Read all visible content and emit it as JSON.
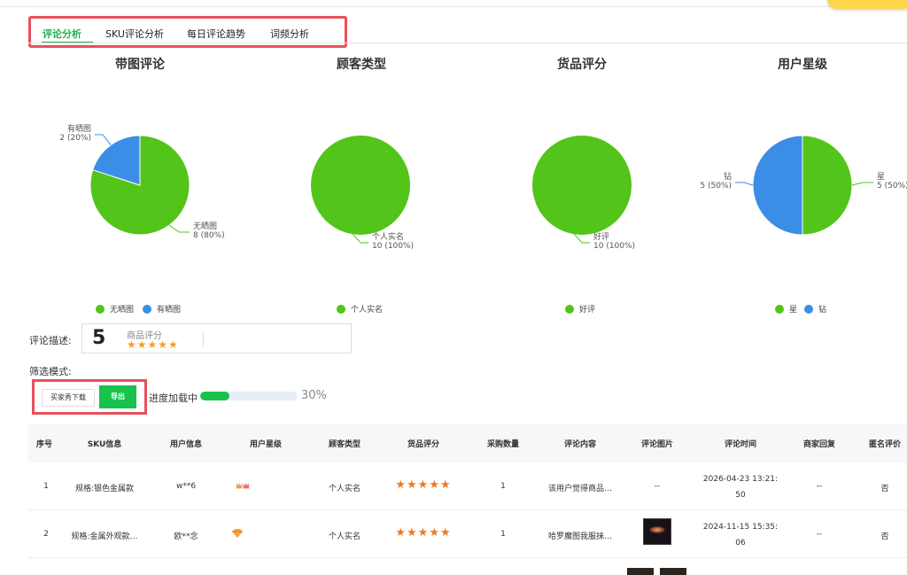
{
  "tabs": [
    {
      "label": "评论分析",
      "active": true
    },
    {
      "label": "SKU评论分析",
      "active": false
    },
    {
      "label": "每日评论趋势",
      "active": false
    },
    {
      "label": "词频分析",
      "active": false
    }
  ],
  "colors": {
    "green": "#52c41a",
    "blue": "#3a8ee6",
    "brand_green": "#19c24c",
    "star": "#f0781e"
  },
  "chart_data": [
    {
      "type": "pie",
      "title": "带图评论",
      "slices": [
        {
          "label": "无晒图",
          "value": 8,
          "percent": 80,
          "color": "#52c41a"
        },
        {
          "label": "有晒图",
          "value": 2,
          "percent": 20,
          "color": "#3a8ee6"
        }
      ],
      "legend": [
        "无晒图",
        "有晒图"
      ]
    },
    {
      "type": "pie",
      "title": "顾客类型",
      "slices": [
        {
          "label": "个人实名",
          "value": 10,
          "percent": 100,
          "color": "#52c41a"
        }
      ],
      "legend": [
        "个人实名"
      ]
    },
    {
      "type": "pie",
      "title": "货品评分",
      "slices": [
        {
          "label": "好评",
          "value": 10,
          "percent": 100,
          "color": "#52c41a"
        }
      ],
      "legend": [
        "好评"
      ]
    },
    {
      "type": "pie",
      "title": "用户星级",
      "slices": [
        {
          "label": "星",
          "value": 5,
          "percent": 50,
          "color": "#52c41a"
        },
        {
          "label": "钻",
          "value": 5,
          "percent": 50,
          "color": "#3a8ee6"
        }
      ],
      "legend": [
        "星",
        "钻"
      ]
    }
  ],
  "rating": {
    "label": "评论描述:",
    "score": "5",
    "sub_label": "商品评分",
    "stars": "★★★★★"
  },
  "filter": {
    "label": "筛选模式:"
  },
  "actions": {
    "buyer_show_download": "买家秀下载",
    "export": "导出"
  },
  "progress": {
    "label": "进度加载中",
    "percent_text": "30%",
    "fraction": 0.3
  },
  "table": {
    "headers": [
      "序号",
      "SKU信息",
      "用户信息",
      "用户星级",
      "顾客类型",
      "货品评分",
      "采购数量",
      "评论内容",
      "评论图片",
      "评论时间",
      "商家回复",
      "匿名评价"
    ],
    "rows": [
      {
        "index": "1",
        "sku": "规格:银色金属款",
        "user": "w**6",
        "star_icon": "double-crown-icon",
        "customer_type": "个人实名",
        "score_stars": "★★★★★",
        "qty": "1",
        "content": "该用户觉得商品…",
        "image": "--",
        "time_line1": "2026-04-23 13:21:",
        "time_line2": "50",
        "reply": "--",
        "anonymous": "否"
      },
      {
        "index": "2",
        "sku": "规格:金属外观款…",
        "user": "欧**念",
        "star_icon": "diamond-icon",
        "customer_type": "个人实名",
        "score_stars": "★★★★★",
        "qty": "1",
        "content": "哈罗魔图我服抹…",
        "image": "thumbnail",
        "time_line1": "2024-11-15 15:35:",
        "time_line2": "06",
        "reply": "--",
        "anonymous": "否"
      }
    ]
  }
}
